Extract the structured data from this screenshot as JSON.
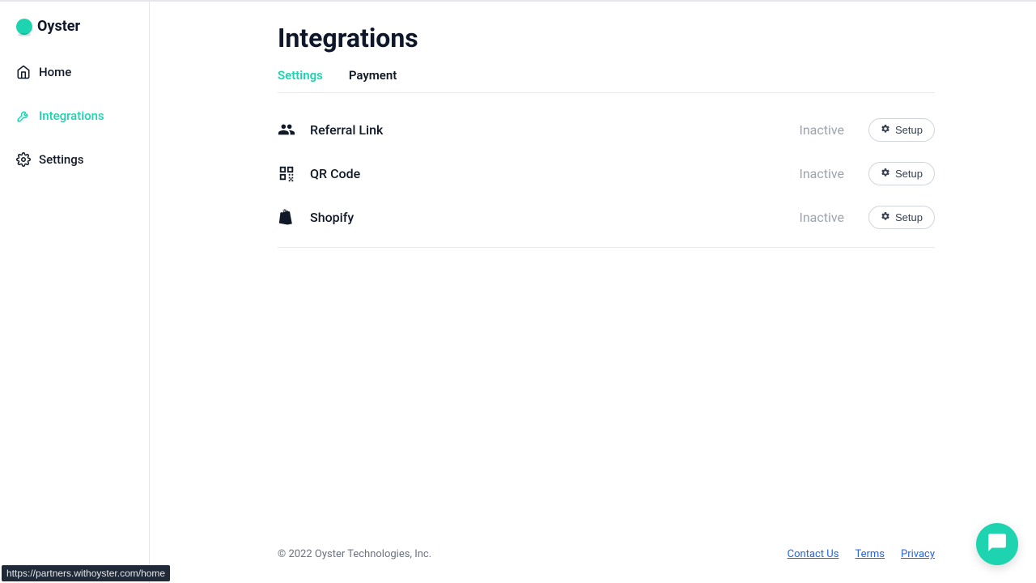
{
  "brand": {
    "name": "Oyster"
  },
  "sidebar": {
    "items": [
      {
        "label": "Home"
      },
      {
        "label": "Integrations"
      },
      {
        "label": "Settings"
      }
    ]
  },
  "page": {
    "title": "Integrations"
  },
  "tabs": [
    {
      "label": "Settings"
    },
    {
      "label": "Payment"
    }
  ],
  "integrations": [
    {
      "label": "Referral Link",
      "status": "Inactive",
      "action": "Setup"
    },
    {
      "label": "QR Code",
      "status": "Inactive",
      "action": "Setup"
    },
    {
      "label": "Shopify",
      "status": "Inactive",
      "action": "Setup"
    }
  ],
  "footer": {
    "copyright": "© 2022 Oyster Technologies, Inc.",
    "links": [
      {
        "label": "Contact Us"
      },
      {
        "label": "Terms"
      },
      {
        "label": "Privacy"
      }
    ]
  },
  "status_url": "https://partners.withoyster.com/home"
}
